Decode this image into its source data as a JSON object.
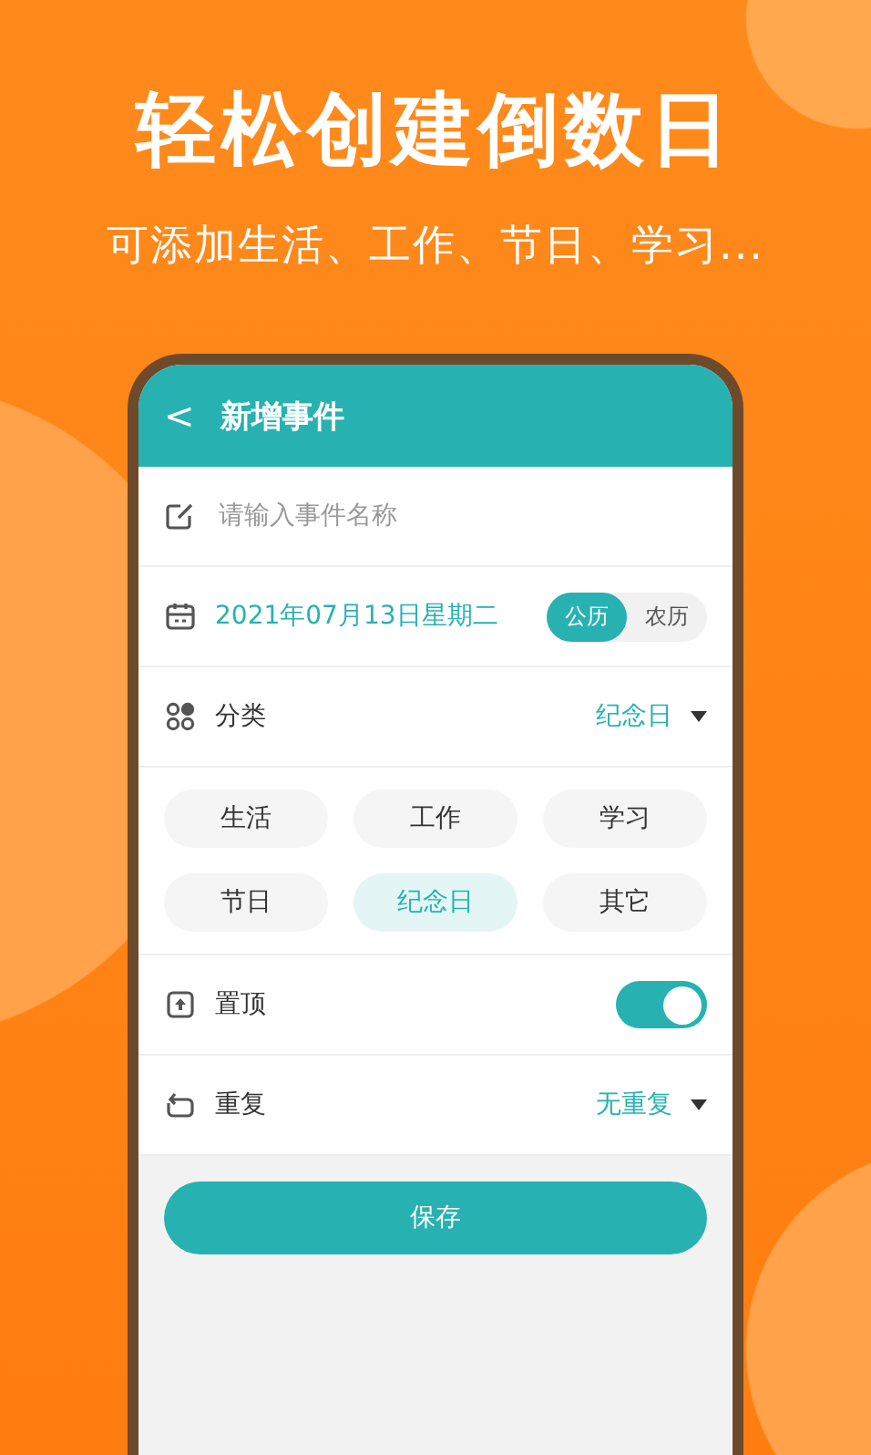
{
  "headline": "轻松创建倒数日",
  "subtitle": "可添加生活、工作、节日、学习...",
  "screen": {
    "title": "新增事件",
    "back": "<",
    "name_field": {
      "placeholder": "请输入事件名称"
    },
    "date": {
      "value": "2021年07月13日星期二",
      "calendars": [
        {
          "label": "公历",
          "selected": true
        },
        {
          "label": "农历",
          "selected": false
        }
      ]
    },
    "category": {
      "label": "分类",
      "value": "纪念日",
      "options": [
        {
          "label": "生活",
          "selected": false
        },
        {
          "label": "工作",
          "selected": false
        },
        {
          "label": "学习",
          "selected": false
        },
        {
          "label": "节日",
          "selected": false
        },
        {
          "label": "纪念日",
          "selected": true
        },
        {
          "label": "其它",
          "selected": false
        }
      ]
    },
    "pin": {
      "label": "置顶",
      "on": true
    },
    "repeat": {
      "label": "重复",
      "value": "无重复"
    },
    "save_button": "保存"
  }
}
